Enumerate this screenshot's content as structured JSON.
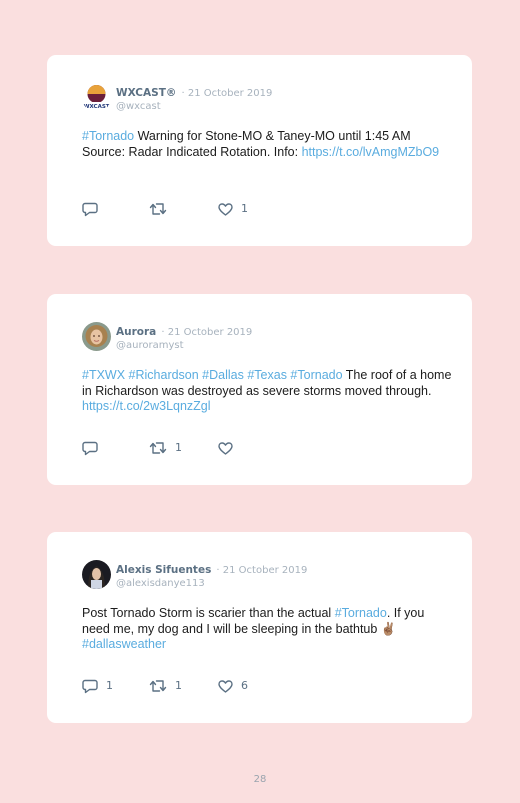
{
  "tweets": [
    {
      "name": "WXCAST®",
      "date": "· 21 October 2019",
      "handle": "@wxcast",
      "text": {
        "tag1": "#Tornado",
        "t1": " Warning for Stone-MO & Taney-MO until 1:45 AM Source: Radar Indicated Rotation. Info: ",
        "link": "https://t.co/lvAmgMZbO9"
      },
      "replies": "",
      "retweets": "",
      "likes": "1"
    },
    {
      "name": "Aurora",
      "date": "· 21 October 2019",
      "handle": "@auroramyst",
      "text": {
        "tags": "#TXWX #Richardson #Dallas #Texas #Tornado",
        "t1": " The roof of a home in Richardson was destroyed as severe storms moved through. ",
        "link": "https://t.co/2w3LqnzZgl"
      },
      "replies": "",
      "retweets": "1",
      "likes": ""
    },
    {
      "name": "Alexis Sifuentes",
      "date": "· 21 October 2019",
      "handle": "@alexisdanye113",
      "text": {
        "t1": "Post Tornado Storm is scarier than the actual ",
        "tag1": "#Tornado",
        "t2": ". If you need me, my dog and I will be sleeping in the bathtub ",
        "emoji": "✌🏽",
        "tag2": "#dallasweather"
      },
      "replies": "1",
      "retweets": "1",
      "likes": "6"
    }
  ],
  "page_number": "28",
  "colors": {
    "background": "#fadfdf",
    "card": "#ffffff",
    "link": "#5aacdf",
    "muted": "#a7b2bd",
    "icon": "#5b7083"
  },
  "icons": [
    "reply-icon",
    "retweet-icon",
    "like-icon"
  ]
}
